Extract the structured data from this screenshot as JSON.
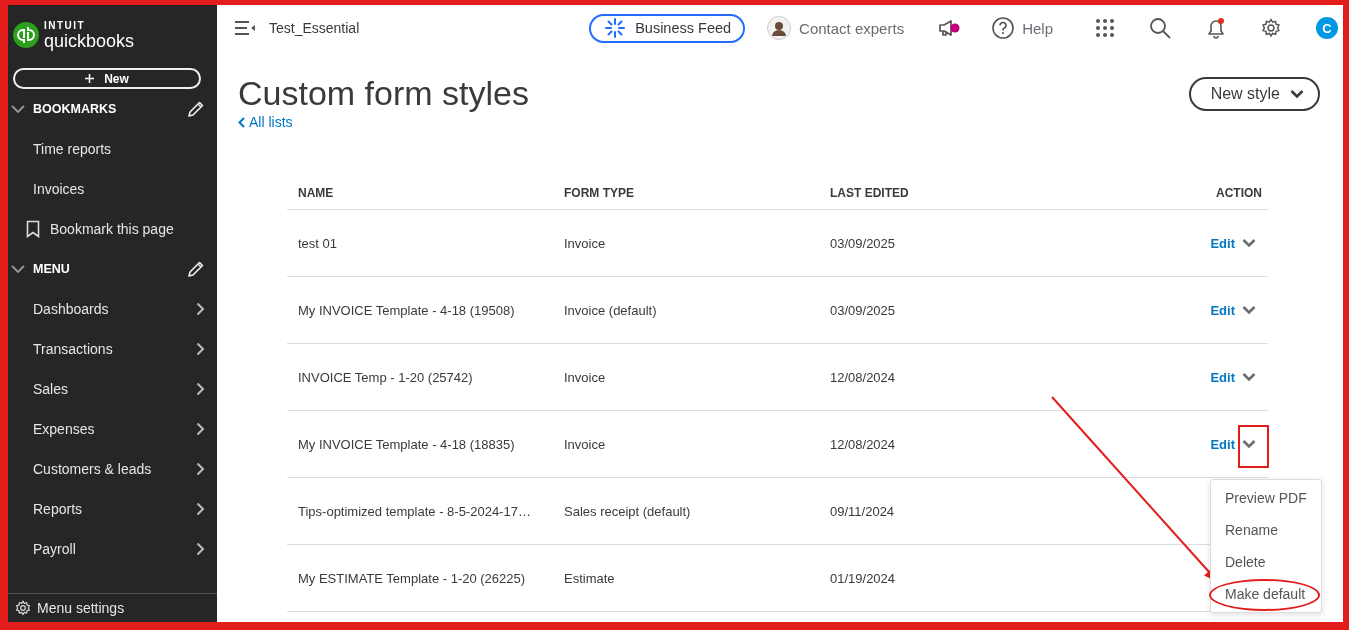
{
  "sidebar": {
    "logo": {
      "brand": "INTUIT",
      "product": "quickbooks"
    },
    "new_button": {
      "label": "New"
    },
    "sections": [
      {
        "title": "BOOKMARKS",
        "expanded": true,
        "items": [
          {
            "label": "Time reports",
            "kind": "link"
          },
          {
            "label": "Invoices",
            "kind": "link"
          },
          {
            "label": "Bookmark this page",
            "kind": "bookmark-action"
          }
        ]
      },
      {
        "title": "MENU",
        "expanded": true,
        "items": [
          {
            "label": "Dashboards",
            "kind": "submenu"
          },
          {
            "label": "Transactions",
            "kind": "submenu"
          },
          {
            "label": "Sales",
            "kind": "submenu"
          },
          {
            "label": "Expenses",
            "kind": "submenu"
          },
          {
            "label": "Customers & leads",
            "kind": "submenu"
          },
          {
            "label": "Reports",
            "kind": "submenu"
          },
          {
            "label": "Payroll",
            "kind": "submenu"
          }
        ]
      }
    ],
    "menu_settings": {
      "label": "Menu settings"
    }
  },
  "topbar": {
    "company": "Test_Essential",
    "business_feed": "Business Feed",
    "contact": "Contact experts",
    "help": "Help",
    "user_initial": "C"
  },
  "page": {
    "title": "Custom form styles",
    "back_link": "All lists",
    "new_style_button": "New style"
  },
  "table": {
    "columns": [
      "NAME",
      "FORM TYPE",
      "LAST EDITED",
      "ACTION"
    ],
    "rows": [
      {
        "name": "test 01",
        "form_type": "Invoice",
        "last_edited": "03/09/2025",
        "action": "Edit",
        "menu_open": false
      },
      {
        "name": "My INVOICE Template - 4-18 (19508)",
        "form_type": "Invoice (default)",
        "last_edited": "03/09/2025",
        "action": "Edit",
        "menu_open": false
      },
      {
        "name": "INVOICE Temp - 1-20 (25742)",
        "form_type": "Invoice",
        "last_edited": "12/08/2024",
        "action": "Edit",
        "menu_open": false
      },
      {
        "name": "My INVOICE Template - 4-18 (18835)",
        "form_type": "Invoice",
        "last_edited": "12/08/2024",
        "action": "Edit",
        "menu_open": true
      },
      {
        "name": "Tips-optimized template - 8-5-2024-17…",
        "form_type": "Sales receipt (default)",
        "last_edited": "09/11/2024",
        "menu_open": false
      },
      {
        "name": "My ESTIMATE Template - 1-20 (26225)",
        "form_type": "Estimate",
        "last_edited": "01/19/2024",
        "menu_open": false
      }
    ],
    "action_menu": [
      {
        "label": "Preview PDF",
        "circled": false
      },
      {
        "label": "Rename",
        "circled": false
      },
      {
        "label": "Delete",
        "circled": false
      },
      {
        "label": "Make default",
        "circled": true
      }
    ]
  }
}
